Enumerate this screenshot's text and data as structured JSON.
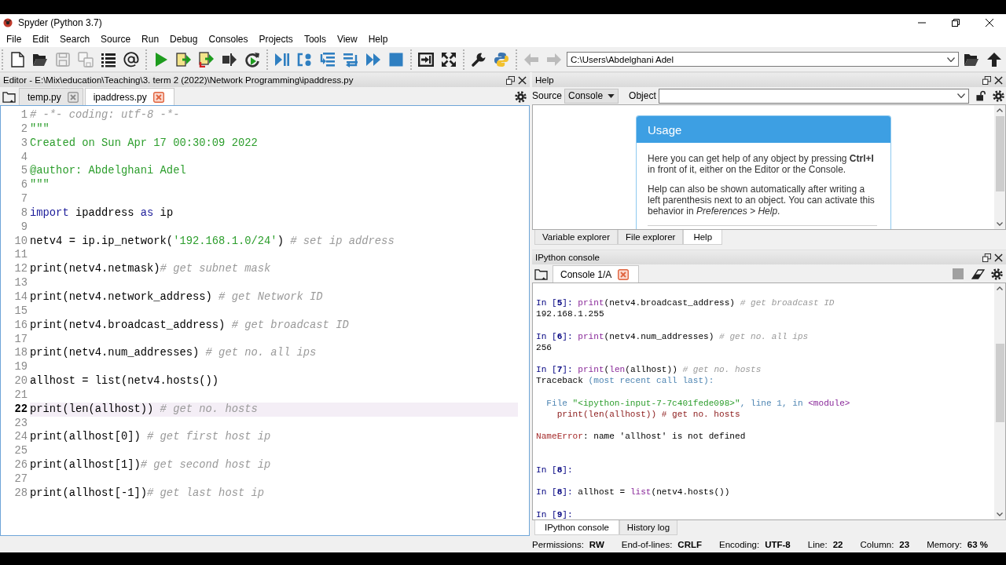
{
  "window": {
    "title": "Spyder (Python 3.7)"
  },
  "menu": [
    "File",
    "Edit",
    "Search",
    "Source",
    "Run",
    "Debug",
    "Consoles",
    "Projects",
    "Tools",
    "View",
    "Help"
  ],
  "toolbar": [
    [
      {
        "kind": "new-file",
        "disabled": false
      },
      {
        "kind": "open",
        "disabled": false
      },
      {
        "kind": "save",
        "disabled": true
      },
      {
        "kind": "save-all",
        "disabled": true
      },
      {
        "kind": "outline",
        "disabled": false
      },
      {
        "kind": "at",
        "disabled": false
      }
    ],
    [
      {
        "kind": "run",
        "disabled": false
      },
      {
        "kind": "run-cell",
        "disabled": false
      },
      {
        "kind": "run-cell-advance",
        "disabled": false
      },
      {
        "kind": "run-selection",
        "disabled": false
      },
      {
        "kind": "rerun",
        "disabled": false
      }
    ],
    [
      {
        "kind": "debug",
        "disabled": false
      },
      {
        "kind": "step",
        "disabled": false
      },
      {
        "kind": "step-into",
        "disabled": false
      },
      {
        "kind": "step-return",
        "disabled": false
      },
      {
        "kind": "continue",
        "disabled": false
      },
      {
        "kind": "stop",
        "disabled": false
      }
    ],
    [
      {
        "kind": "maximize",
        "disabled": false
      },
      {
        "kind": "fullscreen",
        "disabled": false
      }
    ],
    [
      {
        "kind": "preferences",
        "disabled": false
      },
      {
        "kind": "pythonpath",
        "disabled": false
      }
    ]
  ],
  "navigation": {
    "back": {
      "disabled": true
    },
    "forward": {
      "disabled": true
    },
    "path": "C:\\Users\\Abdelghani Adel"
  },
  "editor": {
    "title": "Editor - E:\\Mix\\education\\Teaching\\3. term 2 (2022)\\Network Programming\\ipaddress.py",
    "tabs": [
      {
        "label": "temp.py",
        "selected": false
      },
      {
        "label": "ipaddress.py",
        "selected": true
      }
    ],
    "lines": [
      {
        "number": "1",
        "current": false,
        "segments": [
          {
            "kind": "comment",
            "text": "# -*- coding: utf-8 -*-"
          }
        ]
      },
      {
        "number": "2",
        "current": false,
        "segments": [
          {
            "kind": "docstring",
            "text": "\"\"\""
          }
        ]
      },
      {
        "number": "3",
        "current": false,
        "segments": [
          {
            "kind": "docstring",
            "text": "Created on Sun Apr 17 00:30:09 2022"
          }
        ]
      },
      {
        "number": "4",
        "current": false
      },
      {
        "number": "5",
        "current": false,
        "segments": [
          {
            "kind": "docstring",
            "text": "@author: Abdelghani Adel"
          }
        ]
      },
      {
        "number": "6",
        "current": false,
        "segments": [
          {
            "kind": "docstring",
            "text": "\"\"\""
          }
        ]
      },
      {
        "number": "7",
        "current": false
      },
      {
        "number": "8",
        "current": false,
        "segments": [
          {
            "kind": "keyword",
            "text": "import"
          },
          {
            "kind": "plain",
            "text": " ipaddress "
          },
          {
            "kind": "keyword",
            "text": "as"
          },
          {
            "kind": "plain",
            "text": " ip"
          }
        ]
      },
      {
        "number": "9",
        "current": false
      },
      {
        "number": "10",
        "current": false,
        "segments": [
          {
            "kind": "plain",
            "text": "netv4 = ip.ip_network("
          },
          {
            "kind": "string",
            "text": "'192.168.1.0/24'"
          },
          {
            "kind": "plain",
            "text": ") "
          },
          {
            "kind": "comment",
            "text": "# set ip address"
          }
        ]
      },
      {
        "number": "11",
        "current": false
      },
      {
        "number": "12",
        "current": false,
        "segments": [
          {
            "kind": "plain",
            "text": "print(netv4.netmask)"
          },
          {
            "kind": "comment",
            "text": "# get subnet mask"
          }
        ]
      },
      {
        "number": "13",
        "current": false
      },
      {
        "number": "14",
        "current": false,
        "segments": [
          {
            "kind": "plain",
            "text": "print(netv4.network_address) "
          },
          {
            "kind": "comment",
            "text": "# get Network ID"
          }
        ]
      },
      {
        "number": "15",
        "current": false
      },
      {
        "number": "16",
        "current": false,
        "segments": [
          {
            "kind": "plain",
            "text": "print(netv4.broadcast_address) "
          },
          {
            "kind": "comment",
            "text": "# get broadcast ID"
          }
        ]
      },
      {
        "number": "17",
        "current": false
      },
      {
        "number": "18",
        "current": false,
        "segments": [
          {
            "kind": "plain",
            "text": "print(netv4.num_addresses) "
          },
          {
            "kind": "comment",
            "text": "# get no. all ips"
          }
        ]
      },
      {
        "number": "19",
        "current": false
      },
      {
        "number": "20",
        "current": false,
        "segments": [
          {
            "kind": "plain",
            "text": "allhost = list(netv4.hosts())"
          }
        ]
      },
      {
        "number": "21",
        "current": false
      },
      {
        "number": "22",
        "current": true,
        "segments": [
          {
            "kind": "plain",
            "text": "print(len(allhost)) "
          },
          {
            "kind": "comment",
            "text": "# get no. hosts"
          }
        ]
      },
      {
        "number": "23",
        "current": false
      },
      {
        "number": "24",
        "current": false,
        "segments": [
          {
            "kind": "plain",
            "text": "print(allhost[0]) "
          },
          {
            "kind": "comment",
            "text": "# get first host ip"
          }
        ]
      },
      {
        "number": "25",
        "current": false
      },
      {
        "number": "26",
        "current": false,
        "segments": [
          {
            "kind": "plain",
            "text": "print(allhost[1])"
          },
          {
            "kind": "comment",
            "text": "# get second host ip"
          }
        ]
      },
      {
        "number": "27",
        "current": false
      },
      {
        "number": "28",
        "current": false,
        "segments": [
          {
            "kind": "plain",
            "text": "print(allhost[-1])"
          },
          {
            "kind": "comment",
            "text": "# get last host ip"
          }
        ]
      }
    ]
  },
  "help": {
    "title": "Help",
    "source_label": "Source",
    "source": "Console",
    "object_label": "Object",
    "usage": {
      "title": "Usage",
      "paragraphs": [
        "Here you can get help of any object by pressing **Ctrl+I** in front of it, either on the Editor or the Console.",
        "Help can also be shown automatically after writing a left parenthesis next to an object. You can activate this behavior in *Preferences > Help*."
      ]
    },
    "tabs": [
      {
        "label": "Variable explorer",
        "selected": false
      },
      {
        "label": "File explorer",
        "selected": false
      },
      {
        "label": "Help",
        "selected": true
      }
    ]
  },
  "console": {
    "title": "IPython console",
    "tabs": [
      {
        "label": "Console 1/A",
        "selected": true
      }
    ],
    "stop": {
      "disabled": true
    },
    "lines": [
      {
        "kind": "text",
        "segments": [
          {
            "kind": "prompt",
            "text": "In ["
          },
          {
            "kind": "prompt-number",
            "text": "5"
          },
          {
            "kind": "prompt",
            "text": "]: "
          },
          {
            "kind": "builtin",
            "text": "print"
          },
          {
            "kind": "plain",
            "text": "(netv4.broadcast_address) "
          },
          {
            "kind": "comment",
            "text": "# get broadcast ID"
          }
        ]
      },
      {
        "kind": "text",
        "segments": [
          {
            "kind": "plain",
            "text": "192.168.1.255"
          }
        ]
      },
      {
        "kind": "blank"
      },
      {
        "kind": "text",
        "segments": [
          {
            "kind": "prompt",
            "text": "In ["
          },
          {
            "kind": "prompt-number",
            "text": "6"
          },
          {
            "kind": "prompt",
            "text": "]: "
          },
          {
            "kind": "builtin",
            "text": "print"
          },
          {
            "kind": "plain",
            "text": "(netv4.num_addresses) "
          },
          {
            "kind": "comment",
            "text": "# get no. all ips"
          }
        ]
      },
      {
        "kind": "text",
        "segments": [
          {
            "kind": "plain",
            "text": "256"
          }
        ]
      },
      {
        "kind": "blank"
      },
      {
        "kind": "text",
        "segments": [
          {
            "kind": "prompt",
            "text": "In ["
          },
          {
            "kind": "prompt-number",
            "text": "7"
          },
          {
            "kind": "prompt",
            "text": "]: "
          },
          {
            "kind": "builtin",
            "text": "print"
          },
          {
            "kind": "plain",
            "text": "("
          },
          {
            "kind": "builtin",
            "text": "len"
          },
          {
            "kind": "plain",
            "text": "(allhost)) "
          },
          {
            "kind": "comment",
            "text": "# get no. hosts"
          }
        ]
      },
      {
        "kind": "text",
        "segments": [
          {
            "kind": "plain",
            "text": "Traceback "
          },
          {
            "kind": "traceback",
            "text": "(most recent call last):"
          }
        ]
      },
      {
        "kind": "blank"
      },
      {
        "kind": "text",
        "segments": [
          {
            "kind": "traceback",
            "text": "  File "
          },
          {
            "kind": "string",
            "text": "\"<ipython-input-7-7c401fede098>\""
          },
          {
            "kind": "traceback",
            "text": ", line 1, in "
          },
          {
            "kind": "module",
            "text": "<module>"
          }
        ]
      },
      {
        "kind": "text",
        "segments": [
          {
            "kind": "error-source",
            "text": "    print(len(allhost)) # get no. hosts"
          }
        ]
      },
      {
        "kind": "blank"
      },
      {
        "kind": "text",
        "segments": [
          {
            "kind": "error",
            "text": "NameError"
          },
          {
            "kind": "plain",
            "text": ": name 'allhost' is not defined"
          }
        ]
      },
      {
        "kind": "blank"
      },
      {
        "kind": "blank"
      },
      {
        "kind": "text",
        "segments": [
          {
            "kind": "prompt",
            "text": "In ["
          },
          {
            "kind": "prompt-number",
            "text": "8"
          },
          {
            "kind": "prompt",
            "text": "]:"
          }
        ]
      },
      {
        "kind": "blank"
      },
      {
        "kind": "text",
        "segments": [
          {
            "kind": "prompt",
            "text": "In ["
          },
          {
            "kind": "prompt-number",
            "text": "8"
          },
          {
            "kind": "prompt",
            "text": "]: "
          },
          {
            "kind": "plain",
            "text": "allhost = "
          },
          {
            "kind": "builtin",
            "text": "list"
          },
          {
            "kind": "plain",
            "text": "(netv4.hosts())"
          }
        ]
      },
      {
        "kind": "blank"
      },
      {
        "kind": "text",
        "segments": [
          {
            "kind": "prompt",
            "text": "In ["
          },
          {
            "kind": "prompt-number",
            "text": "9"
          },
          {
            "kind": "prompt",
            "text": "]:"
          }
        ]
      }
    ],
    "bottom_tabs": [
      {
        "label": "IPython console",
        "selected": true
      },
      {
        "label": "History log",
        "selected": false
      }
    ]
  },
  "status_bar": [
    {
      "label": "Permissions:",
      "value": "RW"
    },
    {
      "label": "End-of-lines:",
      "value": "CRLF"
    },
    {
      "label": "Encoding:",
      "value": "UTF-8"
    },
    {
      "label": "Line:",
      "value": "22"
    },
    {
      "label": "Column:",
      "value": "23"
    },
    {
      "label": "Memory:",
      "value": "63 %"
    }
  ]
}
